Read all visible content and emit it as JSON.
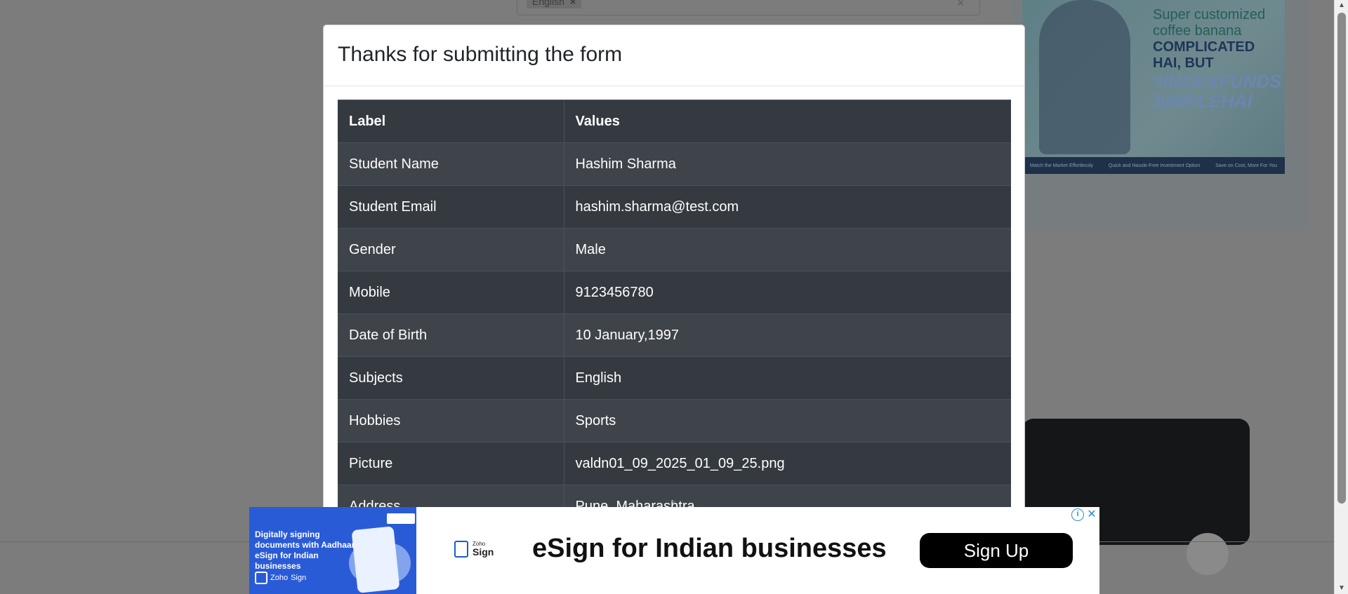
{
  "background": {
    "subjects_chip": "English",
    "chip_remove": "×",
    "clear": "×",
    "ad": {
      "line1": "Super customized coffee banana",
      "line2": "COMPLICATED HAI, BUT",
      "line3": "#INDEXFUNDS SIMPLEHAI",
      "steps": [
        "Match the Market Effortlessly",
        "Quick and Hassle-Free Investment Option",
        "Save on Cost, More For You"
      ]
    }
  },
  "modal": {
    "title": "Thanks for submitting the form",
    "table": {
      "headers": [
        "Label",
        "Values"
      ],
      "rows": [
        {
          "label": "Student Name",
          "value": "Hashim Sharma"
        },
        {
          "label": "Student Email",
          "value": "hashim.sharma@test.com"
        },
        {
          "label": "Gender",
          "value": "Male"
        },
        {
          "label": "Mobile",
          "value": "9123456780"
        },
        {
          "label": "Date of Birth",
          "value": "10 January,1997"
        },
        {
          "label": "Subjects",
          "value": "English"
        },
        {
          "label": "Hobbies",
          "value": "Sports"
        },
        {
          "label": "Picture",
          "value": "valdn01_09_2025_01_09_25.png"
        },
        {
          "label": "Address",
          "value": "Pune, Maharashtra"
        }
      ]
    }
  },
  "ad_banner": {
    "left_text": "Digitally signing documents with Aadhaar eSign for Indian businesses",
    "left_logo_small": "Zoho",
    "left_logo": "Sign",
    "zoho_small": "Zoho",
    "zoho_name": "Sign",
    "headline": "eSign for Indian businesses",
    "cta": "Sign Up",
    "info": "i",
    "close": "✕",
    "collapse": "⌄"
  },
  "scrollbar": {
    "up": "▲",
    "down": "▼"
  }
}
